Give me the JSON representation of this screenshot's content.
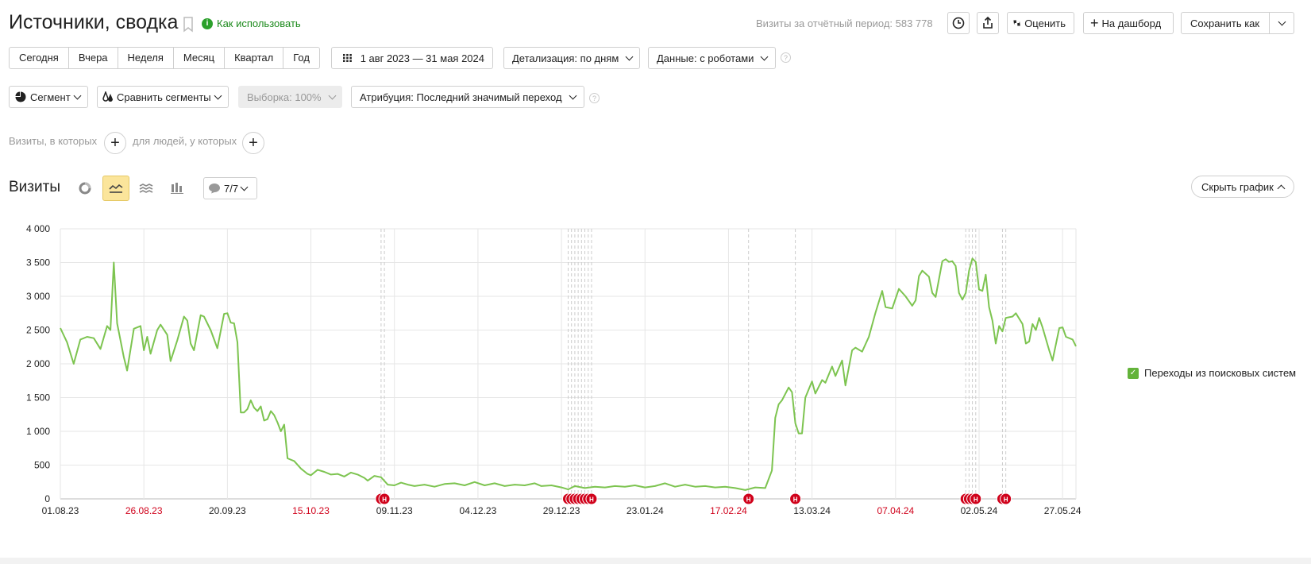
{
  "header": {
    "title": "Источники, сводка",
    "howto_label": "Как использовать",
    "visits_total": "Визиты за отчётный период: 583 778",
    "rate_label": "Оценить",
    "dashboard_label": "На дашборд",
    "save_as_label": "Сохранить как"
  },
  "periods": [
    "Сегодня",
    "Вчера",
    "Неделя",
    "Месяц",
    "Квартал",
    "Год"
  ],
  "toolbar": {
    "date_range": "1 авг 2023 — 31 мая 2024",
    "detail": "Детализация: по дням",
    "data": "Данные: с роботами",
    "segment": "Сегмент",
    "compare": "Сравнить сегменты",
    "sample": "Выборка: 100%",
    "attribution": "Атрибуция: Последний значимый переход"
  },
  "filters": {
    "visits_label": "Визиты, в которых",
    "people_label": "для людей, у которых"
  },
  "section": {
    "title": "Визиты",
    "notes_count": "7/7",
    "hide_chart": "Скрыть график"
  },
  "chart_data": {
    "type": "line",
    "x_start": "2023-08-01",
    "x_end": "2024-05-31",
    "ylim": [
      0,
      4000
    ],
    "y_ticks": [
      "0",
      "500",
      "1 000",
      "1 500",
      "2 000",
      "2 500",
      "3 000",
      "3 500",
      "4 000"
    ],
    "x_ticks": [
      {
        "label": "01.08.23",
        "weekend": false
      },
      {
        "label": "26.08.23",
        "weekend": true
      },
      {
        "label": "20.09.23",
        "weekend": false
      },
      {
        "label": "15.10.23",
        "weekend": true
      },
      {
        "label": "09.11.23",
        "weekend": false
      },
      {
        "label": "04.12.23",
        "weekend": false
      },
      {
        "label": "29.12.23",
        "weekend": false
      },
      {
        "label": "23.01.24",
        "weekend": false
      },
      {
        "label": "17.02.24",
        "weekend": true
      },
      {
        "label": "13.03.24",
        "weekend": false
      },
      {
        "label": "07.04.24",
        "weekend": true
      },
      {
        "label": "02.05.24",
        "weekend": false
      },
      {
        "label": "27.05.24",
        "weekend": false
      }
    ],
    "series": [
      {
        "name": "Переходы из поисковых систем",
        "color": "#7dc450",
        "points": [
          [
            "2023-08-01",
            2530
          ],
          [
            "2023-08-03",
            2320
          ],
          [
            "2023-08-05",
            2000
          ],
          [
            "2023-08-07",
            2360
          ],
          [
            "2023-08-09",
            2400
          ],
          [
            "2023-08-11",
            2380
          ],
          [
            "2023-08-13",
            2220
          ],
          [
            "2023-08-15",
            2560
          ],
          [
            "2023-08-16",
            2500
          ],
          [
            "2023-08-17",
            3500
          ],
          [
            "2023-08-18",
            2600
          ],
          [
            "2023-08-20",
            2100
          ],
          [
            "2023-08-21",
            1900
          ],
          [
            "2023-08-23",
            2520
          ],
          [
            "2023-08-25",
            2560
          ],
          [
            "2023-08-26",
            2200
          ],
          [
            "2023-08-27",
            2400
          ],
          [
            "2023-08-28",
            2150
          ],
          [
            "2023-08-30",
            2500
          ],
          [
            "2023-08-31",
            2580
          ],
          [
            "2023-09-02",
            2430
          ],
          [
            "2023-09-03",
            2040
          ],
          [
            "2023-09-05",
            2350
          ],
          [
            "2023-09-07",
            2700
          ],
          [
            "2023-09-08",
            2640
          ],
          [
            "2023-09-09",
            2300
          ],
          [
            "2023-09-10",
            2200
          ],
          [
            "2023-09-12",
            2720
          ],
          [
            "2023-09-13",
            2700
          ],
          [
            "2023-09-15",
            2500
          ],
          [
            "2023-09-17",
            2230
          ],
          [
            "2023-09-19",
            2740
          ],
          [
            "2023-09-20",
            2750
          ],
          [
            "2023-09-21",
            2610
          ],
          [
            "2023-09-22",
            2600
          ],
          [
            "2023-09-23",
            2320
          ],
          [
            "2023-09-24",
            1280
          ],
          [
            "2023-09-25",
            1280
          ],
          [
            "2023-09-26",
            1330
          ],
          [
            "2023-09-27",
            1460
          ],
          [
            "2023-09-28",
            1350
          ],
          [
            "2023-09-29",
            1300
          ],
          [
            "2023-09-30",
            1370
          ],
          [
            "2023-10-01",
            1160
          ],
          [
            "2023-10-02",
            1180
          ],
          [
            "2023-10-03",
            1300
          ],
          [
            "2023-10-04",
            1240
          ],
          [
            "2023-10-05",
            1130
          ],
          [
            "2023-10-06",
            1000
          ],
          [
            "2023-10-07",
            1100
          ],
          [
            "2023-10-08",
            600
          ],
          [
            "2023-10-10",
            560
          ],
          [
            "2023-10-12",
            450
          ],
          [
            "2023-10-14",
            370
          ],
          [
            "2023-10-15",
            350
          ],
          [
            "2023-10-17",
            430
          ],
          [
            "2023-10-19",
            400
          ],
          [
            "2023-10-21",
            360
          ],
          [
            "2023-10-23",
            370
          ],
          [
            "2023-10-25",
            330
          ],
          [
            "2023-10-27",
            390
          ],
          [
            "2023-10-29",
            360
          ],
          [
            "2023-10-31",
            310
          ],
          [
            "2023-11-01",
            270
          ],
          [
            "2023-11-03",
            340
          ],
          [
            "2023-11-05",
            320
          ],
          [
            "2023-11-07",
            210
          ],
          [
            "2023-11-09",
            200
          ],
          [
            "2023-11-11",
            240
          ],
          [
            "2023-11-13",
            210
          ],
          [
            "2023-11-15",
            190
          ],
          [
            "2023-11-18",
            210
          ],
          [
            "2023-11-21",
            180
          ],
          [
            "2023-11-24",
            220
          ],
          [
            "2023-11-27",
            230
          ],
          [
            "2023-11-30",
            200
          ],
          [
            "2023-12-03",
            250
          ],
          [
            "2023-12-06",
            200
          ],
          [
            "2023-12-09",
            230
          ],
          [
            "2023-12-12",
            190
          ],
          [
            "2023-12-15",
            210
          ],
          [
            "2023-12-18",
            200
          ],
          [
            "2023-12-21",
            230
          ],
          [
            "2023-12-23",
            190
          ],
          [
            "2023-12-26",
            200
          ],
          [
            "2023-12-29",
            170
          ],
          [
            "2023-12-31",
            140
          ],
          [
            "2024-01-02",
            190
          ],
          [
            "2024-01-05",
            160
          ],
          [
            "2024-01-08",
            180
          ],
          [
            "2024-01-11",
            170
          ],
          [
            "2024-01-14",
            190
          ],
          [
            "2024-01-17",
            180
          ],
          [
            "2024-01-20",
            200
          ],
          [
            "2024-01-23",
            170
          ],
          [
            "2024-01-26",
            190
          ],
          [
            "2024-01-29",
            230
          ],
          [
            "2024-02-01",
            180
          ],
          [
            "2024-02-04",
            210
          ],
          [
            "2024-02-07",
            180
          ],
          [
            "2024-02-10",
            190
          ],
          [
            "2024-02-13",
            170
          ],
          [
            "2024-02-16",
            180
          ],
          [
            "2024-02-19",
            160
          ],
          [
            "2024-02-22",
            130
          ],
          [
            "2024-02-25",
            170
          ],
          [
            "2024-02-28",
            160
          ],
          [
            "2024-03-01",
            420
          ],
          [
            "2024-03-02",
            1200
          ],
          [
            "2024-03-03",
            1400
          ],
          [
            "2024-03-04",
            1460
          ],
          [
            "2024-03-06",
            1650
          ],
          [
            "2024-03-07",
            1580
          ],
          [
            "2024-03-08",
            1120
          ],
          [
            "2024-03-09",
            970
          ],
          [
            "2024-03-10",
            970
          ],
          [
            "2024-03-11",
            1500
          ],
          [
            "2024-03-13",
            1740
          ],
          [
            "2024-03-14",
            1560
          ],
          [
            "2024-03-16",
            1760
          ],
          [
            "2024-03-17",
            1720
          ],
          [
            "2024-03-19",
            1960
          ],
          [
            "2024-03-20",
            1820
          ],
          [
            "2024-03-22",
            2050
          ],
          [
            "2024-03-23",
            1680
          ],
          [
            "2024-03-25",
            2200
          ],
          [
            "2024-03-26",
            2240
          ],
          [
            "2024-03-28",
            2180
          ],
          [
            "2024-03-30",
            2400
          ],
          [
            "2024-04-01",
            2760
          ],
          [
            "2024-04-03",
            3080
          ],
          [
            "2024-04-04",
            2840
          ],
          [
            "2024-04-06",
            2820
          ],
          [
            "2024-04-08",
            3110
          ],
          [
            "2024-04-10",
            3000
          ],
          [
            "2024-04-12",
            2860
          ],
          [
            "2024-04-13",
            2940
          ],
          [
            "2024-04-14",
            3300
          ],
          [
            "2024-04-15",
            3380
          ],
          [
            "2024-04-17",
            3290
          ],
          [
            "2024-04-18",
            3050
          ],
          [
            "2024-04-19",
            2990
          ],
          [
            "2024-04-21",
            3520
          ],
          [
            "2024-04-22",
            3550
          ],
          [
            "2024-04-23",
            3510
          ],
          [
            "2024-04-24",
            3520
          ],
          [
            "2024-04-25",
            3450
          ],
          [
            "2024-04-26",
            3050
          ],
          [
            "2024-04-27",
            2950
          ],
          [
            "2024-04-28",
            3050
          ],
          [
            "2024-04-29",
            3380
          ],
          [
            "2024-04-30",
            3560
          ],
          [
            "2024-05-01",
            3510
          ],
          [
            "2024-05-02",
            3100
          ],
          [
            "2024-05-03",
            3080
          ],
          [
            "2024-05-04",
            3320
          ],
          [
            "2024-05-05",
            2840
          ],
          [
            "2024-05-06",
            2640
          ],
          [
            "2024-05-07",
            2300
          ],
          [
            "2024-05-08",
            2560
          ],
          [
            "2024-05-09",
            2480
          ],
          [
            "2024-05-10",
            2680
          ],
          [
            "2024-05-12",
            2700
          ],
          [
            "2024-05-13",
            2750
          ],
          [
            "2024-05-15",
            2590
          ],
          [
            "2024-05-16",
            2300
          ],
          [
            "2024-05-17",
            2330
          ],
          [
            "2024-05-18",
            2590
          ],
          [
            "2024-05-19",
            2500
          ],
          [
            "2024-05-20",
            2680
          ],
          [
            "2024-05-21",
            2540
          ],
          [
            "2024-05-23",
            2200
          ],
          [
            "2024-05-24",
            2050
          ],
          [
            "2024-05-26",
            2530
          ],
          [
            "2024-05-27",
            2540
          ],
          [
            "2024-05-28",
            2400
          ],
          [
            "2024-05-30",
            2360
          ],
          [
            "2024-05-31",
            2260
          ]
        ]
      }
    ],
    "notes": [
      {
        "date": "2023-11-05",
        "label": "Н"
      },
      {
        "date": "2023-11-06",
        "label": "Н"
      },
      {
        "date": "2023-12-31",
        "label": "Н"
      },
      {
        "date": "2024-01-01",
        "label": "Н"
      },
      {
        "date": "2024-01-02",
        "label": "Н"
      },
      {
        "date": "2024-01-03",
        "label": "Н"
      },
      {
        "date": "2024-01-04",
        "label": "Н"
      },
      {
        "date": "2024-01-05",
        "label": "Н"
      },
      {
        "date": "2024-01-06",
        "label": "Н"
      },
      {
        "date": "2024-01-07",
        "label": "Н"
      },
      {
        "date": "2024-02-23",
        "label": "Н"
      },
      {
        "date": "2024-03-08",
        "label": "Н"
      },
      {
        "date": "2024-04-28",
        "label": "Н"
      },
      {
        "date": "2024-04-29",
        "label": "Н"
      },
      {
        "date": "2024-04-30",
        "label": "Н"
      },
      {
        "date": "2024-05-01",
        "label": "Н"
      },
      {
        "date": "2024-05-09",
        "label": "Н"
      },
      {
        "date": "2024-05-10",
        "label": "Н"
      }
    ]
  },
  "legend": {
    "label": "Переходы из поисковых систем",
    "checked": true
  }
}
